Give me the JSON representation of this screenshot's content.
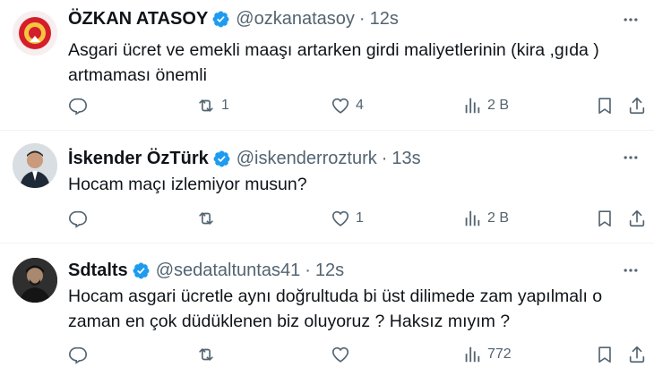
{
  "tweets": [
    {
      "name": "ÖZKAN ATASOY",
      "handle": "@ozkanatasoy",
      "dot": "·",
      "time": "12s",
      "text_lines": [
        "Asgari ücret ve emekli maaşı artarken girdi maliyetlerinin (kira ,gıda )",
        "artmaması önemli"
      ],
      "replies": "",
      "retweets": "1",
      "likes": "4",
      "views": "2 B"
    },
    {
      "name": "İskender ÖzTürk",
      "handle": "@iskenderrozturk",
      "dot": "·",
      "time": "13s",
      "text_lines": [
        "Hocam maçı izlemiyor musun?"
      ],
      "replies": "",
      "retweets": "",
      "likes": "1",
      "views": "2 B"
    },
    {
      "name": "Sdtalts",
      "handle": "@sedataltuntas41",
      "dot": "·",
      "time": "12s",
      "text_lines": [
        "Hocam asgari ücretle aynı doğrultuda bi üst dilimede zam yapılmalı o",
        "zaman  en çok düdüklenen biz oluyoruz ? Haksız mıyım ?"
      ],
      "replies": "",
      "retweets": "",
      "likes": "",
      "views": "772"
    }
  ],
  "icons": {
    "verified": "verified-badge-icon",
    "more": "more-dots-icon",
    "reply": "reply-icon",
    "retweet": "retweet-icon",
    "like": "heart-icon",
    "views": "views-chart-icon",
    "bookmark": "bookmark-icon",
    "share": "share-icon"
  },
  "colors": {
    "verified": "#1d9bf0",
    "text": "#0f1419",
    "secondary": "#536471",
    "divider": "#eff3f4"
  }
}
